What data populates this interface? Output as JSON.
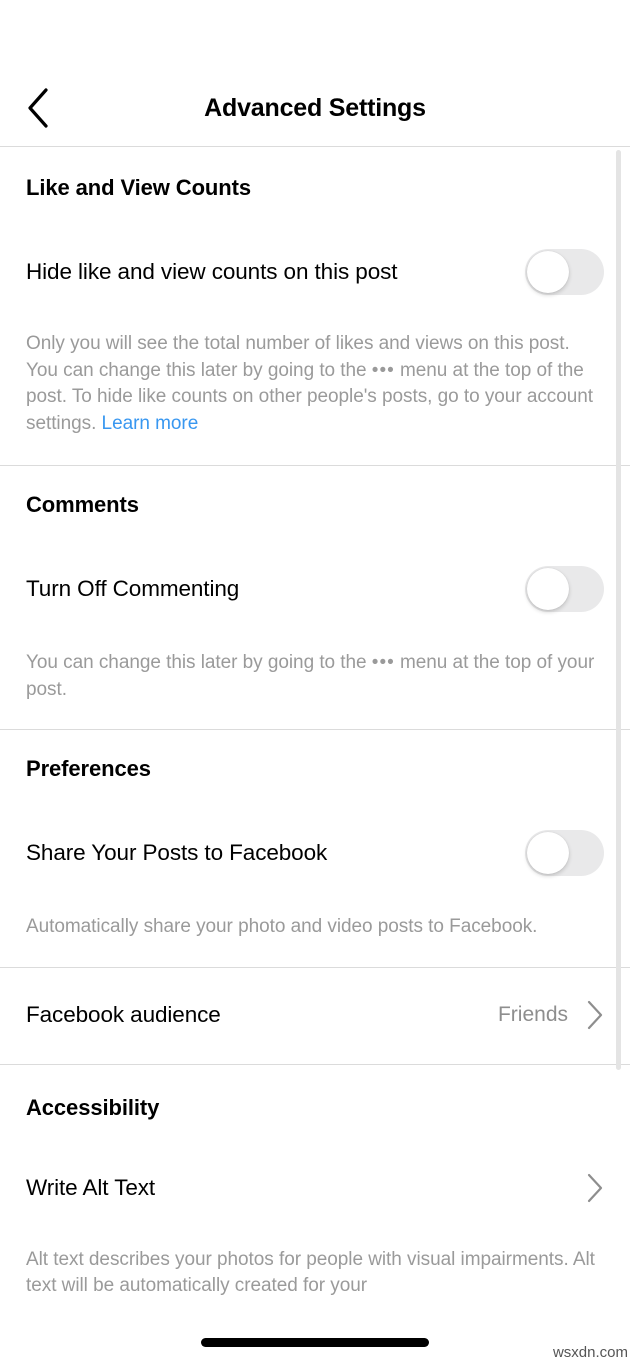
{
  "header": {
    "title": "Advanced Settings",
    "back_icon": "chevron-left-icon"
  },
  "sections": [
    {
      "id": "like_view_counts",
      "title": "Like and View Counts",
      "row_label": "Hide like and view counts on this post",
      "toggle_state": "off",
      "description_part1": "Only you will see the total number of likes and views on this post. You can change this later by going to the ",
      "description_dots": "•••",
      "description_part2": " menu at the top of the post. To hide like counts on other people's posts, go to your account settings. ",
      "link_label": "Learn more"
    },
    {
      "id": "comments",
      "title": "Comments",
      "row_label": "Turn Off Commenting",
      "toggle_state": "off",
      "description_part1": "You can change this later by going to the ",
      "description_dots": "•••",
      "description_part2": " menu at the top of your post."
    },
    {
      "id": "preferences",
      "title": "Preferences",
      "row_label": "Share Your Posts to Facebook",
      "toggle_state": "off",
      "description": "Automatically share your photo and video posts to Facebook."
    },
    {
      "id": "facebook_audience",
      "row_label": "Facebook audience",
      "value": "Friends",
      "chevron_icon": "chevron-right-icon"
    },
    {
      "id": "accessibility",
      "title": "Accessibility",
      "row_label": "Write Alt Text",
      "chevron_icon": "chevron-right-icon",
      "description": "Alt text describes your photos for people with visual impairments. Alt text will be automatically created for your"
    }
  ],
  "watermark": "wsxdn.com",
  "colors": {
    "accent_link": "#3897f0",
    "toggle_off_track": "#e9e9ea",
    "divider": "#dbdbdb",
    "secondary_text": "#9a9a9a",
    "value_text": "#8e8e8e"
  }
}
